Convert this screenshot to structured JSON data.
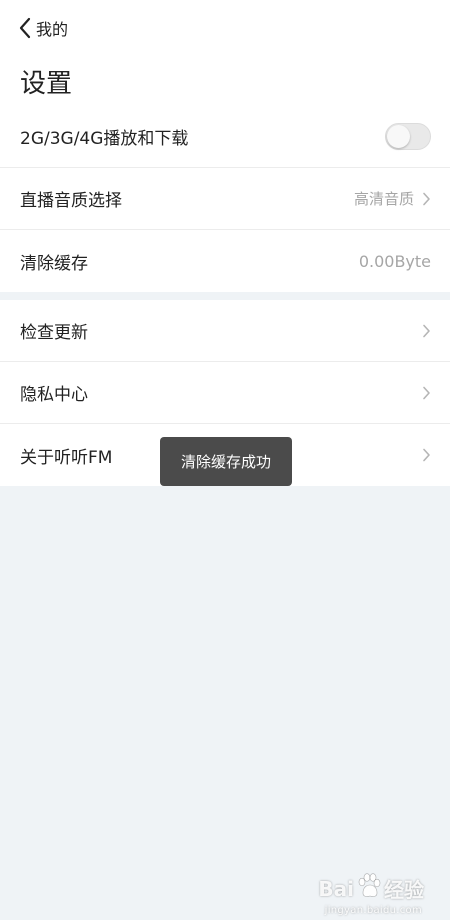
{
  "nav": {
    "back_label": "我的"
  },
  "page_title": "设置",
  "group1": [
    {
      "label": "2G/3G/4G播放和下载",
      "type": "toggle",
      "on": false
    },
    {
      "label": "直播音质选择",
      "value": "高清音质",
      "type": "chevron"
    },
    {
      "label": "清除缓存",
      "value": "0.00Byte",
      "type": "value"
    }
  ],
  "group2": [
    {
      "label": "检查更新",
      "type": "chevron"
    },
    {
      "label": "隐私中心",
      "type": "chevron"
    },
    {
      "label": "关于听听FM",
      "type": "chevron"
    }
  ],
  "toast": "清除缓存成功",
  "watermark": {
    "brand_left": "Bai",
    "brand_right": "经验",
    "sub": "jingyan.baidu.com"
  },
  "colors": {
    "background": "#eff3f6",
    "toast": "#4b4b4b",
    "muted_text": "#a6a6a6"
  }
}
